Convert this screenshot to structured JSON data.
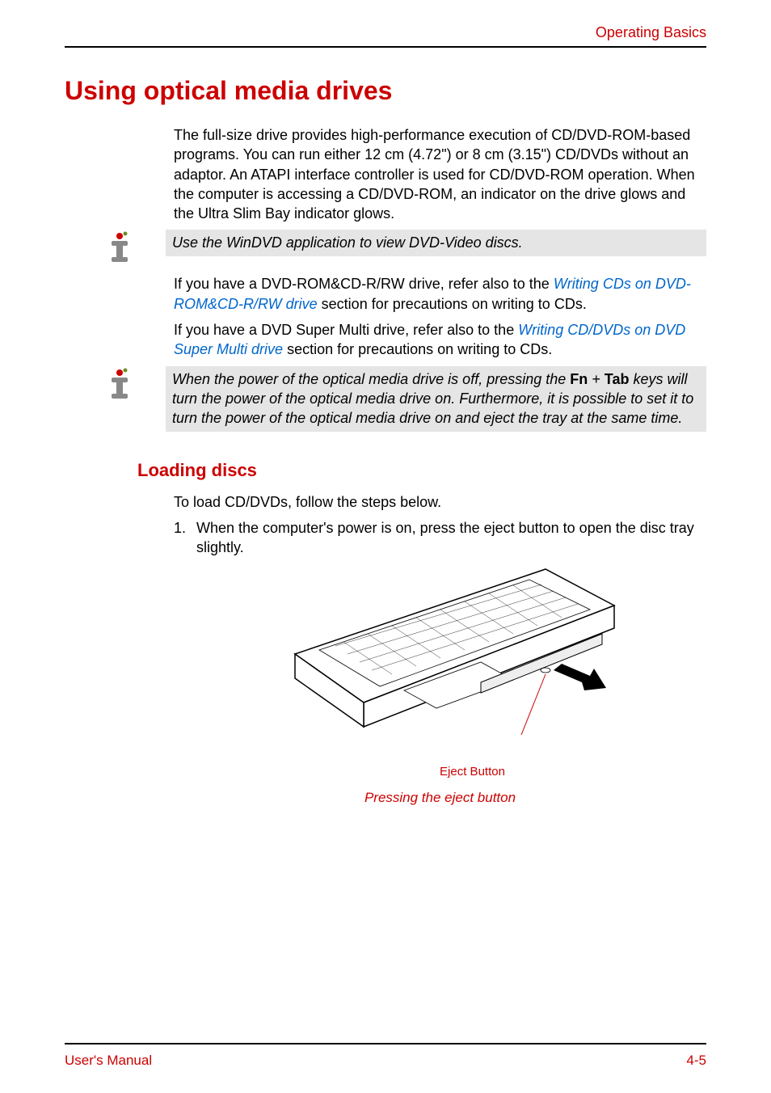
{
  "header": {
    "section_title": "Operating Basics"
  },
  "h1": "Using optical media drives",
  "intro_paragraph": "The full-size drive provides high-performance execution of CD/DVD-ROM-based programs. You can run either 12 cm (4.72\") or 8 cm (3.15\") CD/DVDs without an adaptor. An ATAPI interface controller is used for CD/DVD-ROM operation. When the computer is accessing a CD/DVD-ROM, an indicator on the drive glows and the Ultra Slim Bay indicator glows.",
  "note1": "Use the WinDVD application to view DVD-Video discs.",
  "para2_a": "If you have a DVD-ROM&CD-R/RW drive, refer also to the ",
  "para2_link": "Writing CDs on DVD-ROM&CD-R/RW drive",
  "para2_b": " section for precautions on writing to CDs.",
  "para3_a": "If you have a DVD Super Multi drive, refer also to the ",
  "para3_link": "Writing CD/DVDs on DVD Super Multi drive",
  "para3_b": " section for precautions on writing to CDs.",
  "note2_a": "When the power of the optical media drive is off, pressing the ",
  "note2_fn": "Fn",
  "note2_plus": " + ",
  "note2_tab": "Tab",
  "note2_b": " keys will turn the power of the optical media drive on. Furthermore, it is possible to set it to turn the power of the optical media drive on and eject the tray at the same time.",
  "h2": "Loading discs",
  "loading_intro": "To load CD/DVDs, follow the steps below.",
  "step1_num": "1.",
  "step1_text": "When the computer's power is on, press the eject button to open the disc tray slightly.",
  "figure_label": "Eject Button",
  "figure_caption": "Pressing the eject button",
  "footer": {
    "left": "User's Manual",
    "right": "4-5"
  }
}
